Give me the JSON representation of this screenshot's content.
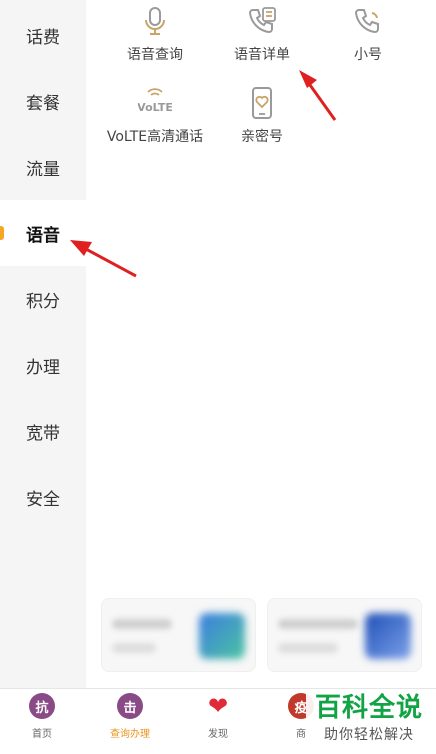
{
  "sidebar": {
    "items": [
      {
        "label": "话费"
      },
      {
        "label": "套餐"
      },
      {
        "label": "流量"
      },
      {
        "label": "语音"
      },
      {
        "label": "积分"
      },
      {
        "label": "办理"
      },
      {
        "label": "宽带"
      },
      {
        "label": "安全"
      }
    ],
    "active_index": 3
  },
  "features": [
    {
      "label": "语音查询",
      "icon": "microphone-icon"
    },
    {
      "label": "语音详单",
      "icon": "phone-list-icon"
    },
    {
      "label": "小号",
      "icon": "phone-icon"
    },
    {
      "label": "VoLTE高清通话",
      "icon": "volte-icon",
      "icon_text": "VoLTE"
    },
    {
      "label": "亲密号",
      "icon": "heart-phone-icon"
    }
  ],
  "tabbar": {
    "items": [
      {
        "label": "首页",
        "icon": "home-icon",
        "glyph": "抗"
      },
      {
        "label": "查询办理",
        "icon": "query-icon",
        "glyph": "击"
      },
      {
        "label": "发现",
        "icon": "heart-icon",
        "glyph": "❤"
      },
      {
        "label": "商",
        "icon": "shop-icon",
        "glyph": "疫"
      }
    ],
    "active_index": 1
  },
  "watermark": {
    "title": "百科全说",
    "subtitle": "助你轻松解决"
  },
  "colors": {
    "accent": "#e8951c",
    "icon_tan": "#c9a46a",
    "arrow": "#e02020",
    "brand_green": "#12a345"
  }
}
